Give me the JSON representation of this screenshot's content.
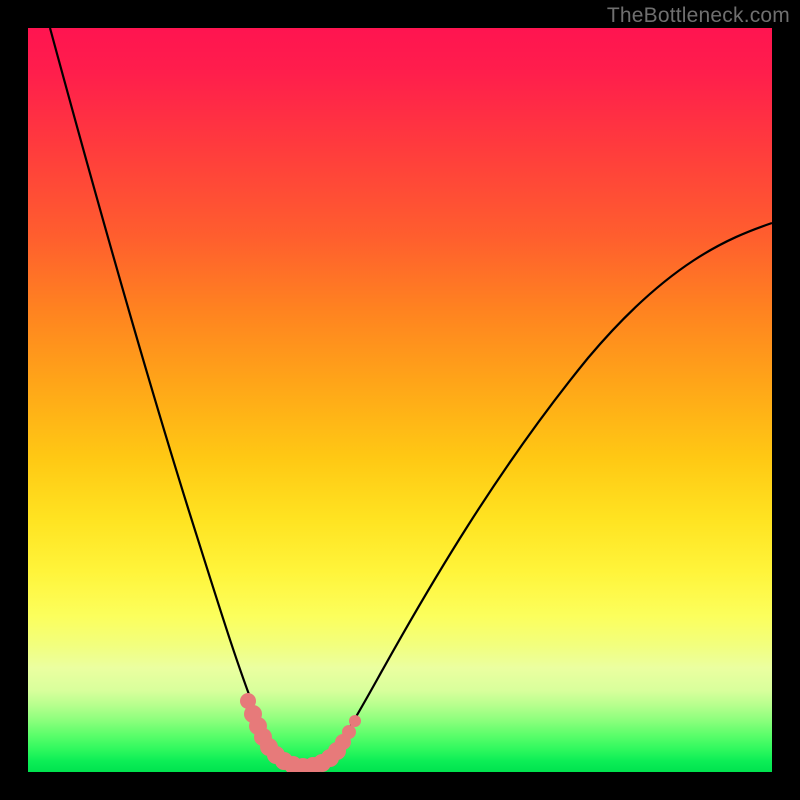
{
  "watermark": "TheBottleneck.com",
  "colors": {
    "curve": "#000000",
    "marker": "#e77a7a",
    "gradient_top": "#ff1450",
    "gradient_bottom": "#00e34f"
  },
  "chart_data": {
    "type": "line",
    "title": "",
    "xlabel": "",
    "ylabel": "",
    "xlim": [
      0,
      100
    ],
    "ylim": [
      0,
      100
    ],
    "grid": false,
    "legend": false,
    "annotations": [],
    "series": [
      {
        "name": "left-curve",
        "x": [
          3,
          5,
          7,
          9,
          11,
          13,
          15,
          17,
          19,
          21,
          23,
          25,
          27,
          29,
          30,
          31,
          32,
          33,
          34
        ],
        "y": [
          100,
          92,
          84,
          76,
          68,
          61,
          54,
          47,
          40,
          34,
          28,
          22,
          16,
          11,
          8,
          6,
          4,
          2.5,
          1.5
        ]
      },
      {
        "name": "right-curve",
        "x": [
          40,
          41,
          43,
          45,
          48,
          52,
          56,
          60,
          65,
          70,
          75,
          80,
          85,
          90,
          95,
          100
        ],
        "y": [
          1.5,
          2.5,
          5,
          8,
          12,
          18,
          24,
          30,
          37,
          44,
          50,
          56,
          61,
          66,
          70,
          74
        ]
      },
      {
        "name": "valley-floor",
        "x": [
          34,
          35,
          36,
          37,
          38,
          39,
          40
        ],
        "y": [
          1.5,
          1,
          0.8,
          0.8,
          0.9,
          1.1,
          1.5
        ]
      }
    ],
    "markers": {
      "name": "highlight-dots",
      "color": "#e77a7a",
      "points": [
        {
          "x": 29.5,
          "y": 9.5,
          "r": 1.2
        },
        {
          "x": 30.0,
          "y": 7.5,
          "r": 1.4
        },
        {
          "x": 30.6,
          "y": 6.0,
          "r": 1.4
        },
        {
          "x": 31.2,
          "y": 4.6,
          "r": 1.4
        },
        {
          "x": 31.9,
          "y": 3.4,
          "r": 1.4
        },
        {
          "x": 32.8,
          "y": 2.4,
          "r": 1.4
        },
        {
          "x": 33.8,
          "y": 1.8,
          "r": 1.4
        },
        {
          "x": 35.0,
          "y": 1.2,
          "r": 1.4
        },
        {
          "x": 36.2,
          "y": 1.0,
          "r": 1.4
        },
        {
          "x": 37.5,
          "y": 1.0,
          "r": 1.4
        },
        {
          "x": 38.7,
          "y": 1.2,
          "r": 1.4
        },
        {
          "x": 39.8,
          "y": 1.6,
          "r": 1.4
        },
        {
          "x": 40.8,
          "y": 2.3,
          "r": 1.4
        },
        {
          "x": 41.6,
          "y": 3.2,
          "r": 1.4
        },
        {
          "x": 42.3,
          "y": 4.2,
          "r": 1.2
        },
        {
          "x": 43.2,
          "y": 5.6,
          "r": 1.0
        }
      ]
    }
  }
}
